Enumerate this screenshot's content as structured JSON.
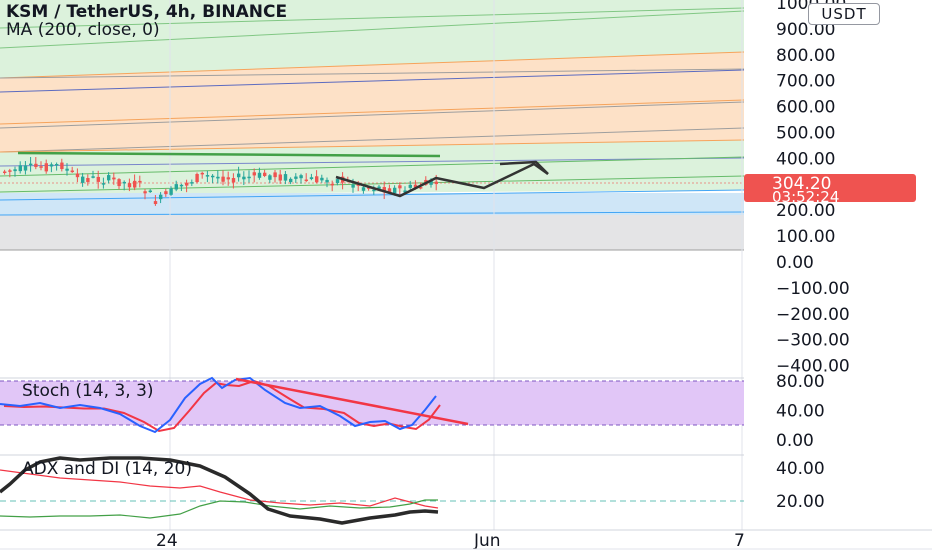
{
  "header": {
    "symbol": "KSM / TetherUS, 4h, BINANCE",
    "ma_label": "MA (200, close, 0)"
  },
  "price_axis": {
    "unit": "USDT",
    "ticks": [
      "1000.00",
      "900.00",
      "800.00",
      "700.00",
      "600.00",
      "500.00",
      "400.00",
      "300.00",
      "200.00",
      "100.00",
      "0.00",
      "−100.00",
      "−200.00",
      "−300.00",
      "−400.00"
    ]
  },
  "price_tag": {
    "price": "304.20",
    "countdown": "03:52:24",
    "color": "#ef5350"
  },
  "stoch": {
    "label": "Stoch (14, 3, 3)",
    "ticks": [
      "80.00",
      "40.00",
      "0.00"
    ],
    "band_color": "#e1c6f7",
    "k_color": "#2962ff",
    "d_color": "#f23645"
  },
  "adx": {
    "label": "ADX and DI (14, 20)",
    "ticks": [
      "40.00",
      "20.00"
    ],
    "adx_color": "#2a2a2a",
    "plus_di_color": "#43a047",
    "minus_di_color": "#f23645"
  },
  "time_axis": {
    "labels": [
      "24",
      "Jun",
      "7"
    ]
  },
  "colors": {
    "green_zone": "#dcf2dc",
    "orange_zone": "#fde1c7",
    "blue_zone": "#cfe6f7",
    "gray_zone": "#e4e4e6",
    "candle_up": "#26a69a",
    "candle_down": "#ef5350"
  }
}
